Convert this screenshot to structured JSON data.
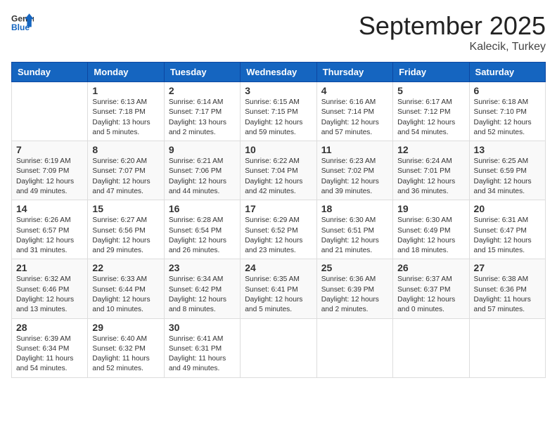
{
  "logo": {
    "general": "General",
    "blue": "Blue"
  },
  "title": "September 2025",
  "location": "Kalecik, Turkey",
  "weekdays": [
    "Sunday",
    "Monday",
    "Tuesday",
    "Wednesday",
    "Thursday",
    "Friday",
    "Saturday"
  ],
  "weeks": [
    [
      null,
      {
        "day": "1",
        "sunrise": "Sunrise: 6:13 AM",
        "sunset": "Sunset: 7:18 PM",
        "daylight": "Daylight: 13 hours and 5 minutes."
      },
      {
        "day": "2",
        "sunrise": "Sunrise: 6:14 AM",
        "sunset": "Sunset: 7:17 PM",
        "daylight": "Daylight: 13 hours and 2 minutes."
      },
      {
        "day": "3",
        "sunrise": "Sunrise: 6:15 AM",
        "sunset": "Sunset: 7:15 PM",
        "daylight": "Daylight: 12 hours and 59 minutes."
      },
      {
        "day": "4",
        "sunrise": "Sunrise: 6:16 AM",
        "sunset": "Sunset: 7:14 PM",
        "daylight": "Daylight: 12 hours and 57 minutes."
      },
      {
        "day": "5",
        "sunrise": "Sunrise: 6:17 AM",
        "sunset": "Sunset: 7:12 PM",
        "daylight": "Daylight: 12 hours and 54 minutes."
      },
      {
        "day": "6",
        "sunrise": "Sunrise: 6:18 AM",
        "sunset": "Sunset: 7:10 PM",
        "daylight": "Daylight: 12 hours and 52 minutes."
      }
    ],
    [
      {
        "day": "7",
        "sunrise": "Sunrise: 6:19 AM",
        "sunset": "Sunset: 7:09 PM",
        "daylight": "Daylight: 12 hours and 49 minutes."
      },
      {
        "day": "8",
        "sunrise": "Sunrise: 6:20 AM",
        "sunset": "Sunset: 7:07 PM",
        "daylight": "Daylight: 12 hours and 47 minutes."
      },
      {
        "day": "9",
        "sunrise": "Sunrise: 6:21 AM",
        "sunset": "Sunset: 7:06 PM",
        "daylight": "Daylight: 12 hours and 44 minutes."
      },
      {
        "day": "10",
        "sunrise": "Sunrise: 6:22 AM",
        "sunset": "Sunset: 7:04 PM",
        "daylight": "Daylight: 12 hours and 42 minutes."
      },
      {
        "day": "11",
        "sunrise": "Sunrise: 6:23 AM",
        "sunset": "Sunset: 7:02 PM",
        "daylight": "Daylight: 12 hours and 39 minutes."
      },
      {
        "day": "12",
        "sunrise": "Sunrise: 6:24 AM",
        "sunset": "Sunset: 7:01 PM",
        "daylight": "Daylight: 12 hours and 36 minutes."
      },
      {
        "day": "13",
        "sunrise": "Sunrise: 6:25 AM",
        "sunset": "Sunset: 6:59 PM",
        "daylight": "Daylight: 12 hours and 34 minutes."
      }
    ],
    [
      {
        "day": "14",
        "sunrise": "Sunrise: 6:26 AM",
        "sunset": "Sunset: 6:57 PM",
        "daylight": "Daylight: 12 hours and 31 minutes."
      },
      {
        "day": "15",
        "sunrise": "Sunrise: 6:27 AM",
        "sunset": "Sunset: 6:56 PM",
        "daylight": "Daylight: 12 hours and 29 minutes."
      },
      {
        "day": "16",
        "sunrise": "Sunrise: 6:28 AM",
        "sunset": "Sunset: 6:54 PM",
        "daylight": "Daylight: 12 hours and 26 minutes."
      },
      {
        "day": "17",
        "sunrise": "Sunrise: 6:29 AM",
        "sunset": "Sunset: 6:52 PM",
        "daylight": "Daylight: 12 hours and 23 minutes."
      },
      {
        "day": "18",
        "sunrise": "Sunrise: 6:30 AM",
        "sunset": "Sunset: 6:51 PM",
        "daylight": "Daylight: 12 hours and 21 minutes."
      },
      {
        "day": "19",
        "sunrise": "Sunrise: 6:30 AM",
        "sunset": "Sunset: 6:49 PM",
        "daylight": "Daylight: 12 hours and 18 minutes."
      },
      {
        "day": "20",
        "sunrise": "Sunrise: 6:31 AM",
        "sunset": "Sunset: 6:47 PM",
        "daylight": "Daylight: 12 hours and 15 minutes."
      }
    ],
    [
      {
        "day": "21",
        "sunrise": "Sunrise: 6:32 AM",
        "sunset": "Sunset: 6:46 PM",
        "daylight": "Daylight: 12 hours and 13 minutes."
      },
      {
        "day": "22",
        "sunrise": "Sunrise: 6:33 AM",
        "sunset": "Sunset: 6:44 PM",
        "daylight": "Daylight: 12 hours and 10 minutes."
      },
      {
        "day": "23",
        "sunrise": "Sunrise: 6:34 AM",
        "sunset": "Sunset: 6:42 PM",
        "daylight": "Daylight: 12 hours and 8 minutes."
      },
      {
        "day": "24",
        "sunrise": "Sunrise: 6:35 AM",
        "sunset": "Sunset: 6:41 PM",
        "daylight": "Daylight: 12 hours and 5 minutes."
      },
      {
        "day": "25",
        "sunrise": "Sunrise: 6:36 AM",
        "sunset": "Sunset: 6:39 PM",
        "daylight": "Daylight: 12 hours and 2 minutes."
      },
      {
        "day": "26",
        "sunrise": "Sunrise: 6:37 AM",
        "sunset": "Sunset: 6:37 PM",
        "daylight": "Daylight: 12 hours and 0 minutes."
      },
      {
        "day": "27",
        "sunrise": "Sunrise: 6:38 AM",
        "sunset": "Sunset: 6:36 PM",
        "daylight": "Daylight: 11 hours and 57 minutes."
      }
    ],
    [
      {
        "day": "28",
        "sunrise": "Sunrise: 6:39 AM",
        "sunset": "Sunset: 6:34 PM",
        "daylight": "Daylight: 11 hours and 54 minutes."
      },
      {
        "day": "29",
        "sunrise": "Sunrise: 6:40 AM",
        "sunset": "Sunset: 6:32 PM",
        "daylight": "Daylight: 11 hours and 52 minutes."
      },
      {
        "day": "30",
        "sunrise": "Sunrise: 6:41 AM",
        "sunset": "Sunset: 6:31 PM",
        "daylight": "Daylight: 11 hours and 49 minutes."
      },
      null,
      null,
      null,
      null
    ]
  ]
}
